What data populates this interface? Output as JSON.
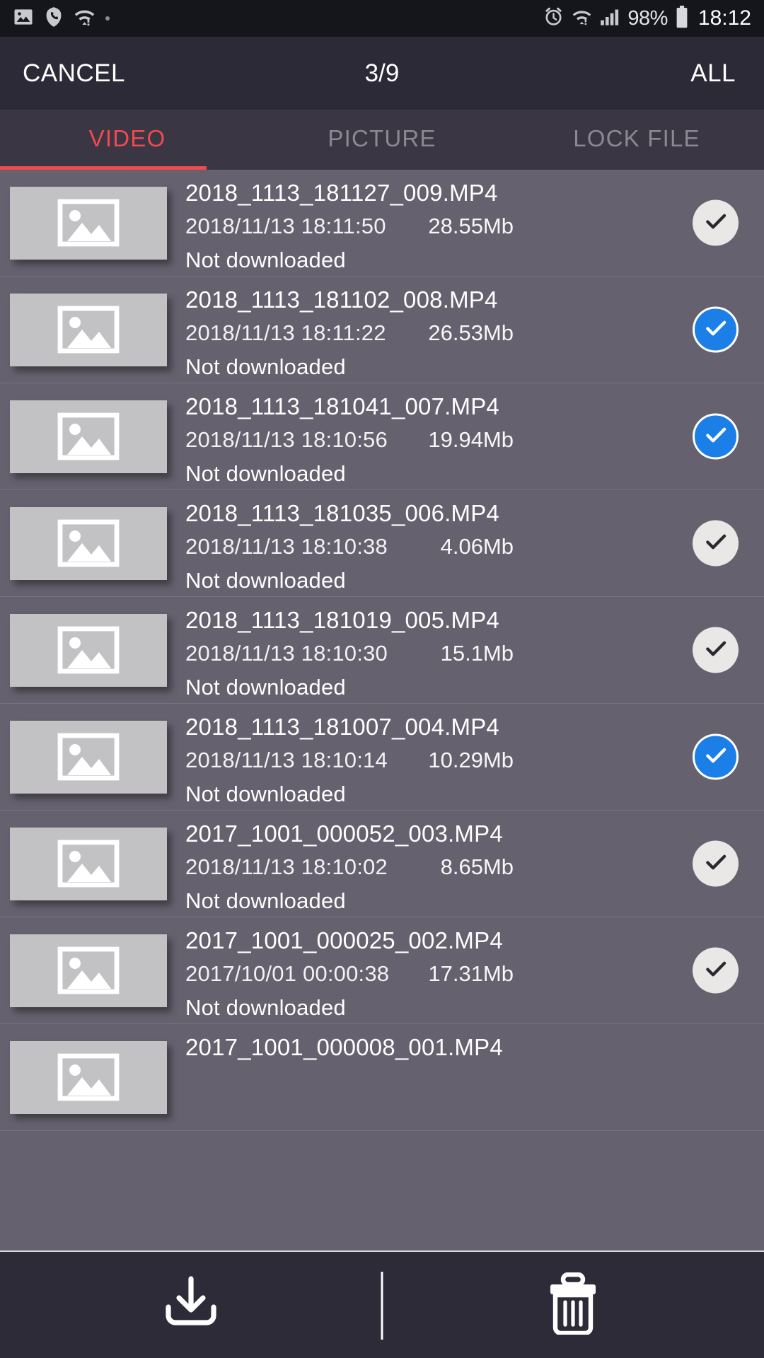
{
  "status_bar": {
    "left_icons": [
      "image-icon",
      "phone-icon",
      "wifi-alert-icon",
      "more-dot-icon"
    ],
    "right_icons": [
      "alarm-icon",
      "wifi-alert-icon",
      "signal-icon",
      "battery-icon"
    ],
    "battery_percent": "98%",
    "clock": "18:12"
  },
  "topbar": {
    "cancel_label": "CANCEL",
    "count_label": "3/9",
    "all_label": "ALL"
  },
  "tabs": {
    "items": [
      {
        "label": "VIDEO",
        "active": true
      },
      {
        "label": "PICTURE",
        "active": false
      },
      {
        "label": "LOCK FILE",
        "active": false
      }
    ],
    "active_color": "#ef4b50",
    "inactive_color": "#8b8892"
  },
  "list": {
    "status_text": "Not downloaded",
    "rows": [
      {
        "name": "2018_1113_181127_009.MP4",
        "date": "2018/11/13 18:11:50",
        "size": "28.55Mb",
        "status": "Not downloaded",
        "selected": false
      },
      {
        "name": "2018_1113_181102_008.MP4",
        "date": "2018/11/13 18:11:22",
        "size": "26.53Mb",
        "status": "Not downloaded",
        "selected": true
      },
      {
        "name": "2018_1113_181041_007.MP4",
        "date": "2018/11/13 18:10:56",
        "size": "19.94Mb",
        "status": "Not downloaded",
        "selected": true
      },
      {
        "name": "2018_1113_181035_006.MP4",
        "date": "2018/11/13 18:10:38",
        "size": "4.06Mb",
        "status": "Not downloaded",
        "selected": false
      },
      {
        "name": "2018_1113_181019_005.MP4",
        "date": "2018/11/13 18:10:30",
        "size": "15.1Mb",
        "status": "Not downloaded",
        "selected": false
      },
      {
        "name": "2018_1113_181007_004.MP4",
        "date": "2018/11/13 18:10:14",
        "size": "10.29Mb",
        "status": "Not downloaded",
        "selected": true
      },
      {
        "name": "2017_1001_000052_003.MP4",
        "date": "2018/11/13 18:10:02",
        "size": "8.65Mb",
        "status": "Not downloaded",
        "selected": false
      },
      {
        "name": "2017_1001_000025_002.MP4",
        "date": "2017/10/01 00:00:38",
        "size": "17.31Mb",
        "status": "Not downloaded",
        "selected": false
      },
      {
        "name": "2017_1001_000008_001.MP4",
        "date": "",
        "size": "",
        "status": "",
        "selected": false
      }
    ]
  },
  "bottombar": {
    "download_label": "download-button",
    "delete_label": "delete-button"
  },
  "colors": {
    "accent": "#ef4b50",
    "checked": "#1c7fe8",
    "unchecked": "#e9e8e6",
    "list_bg": "#65616e",
    "topbar_bg": "#2d2a38",
    "tabs_bg": "#3a3644",
    "statusbar_bg": "#15151c"
  }
}
